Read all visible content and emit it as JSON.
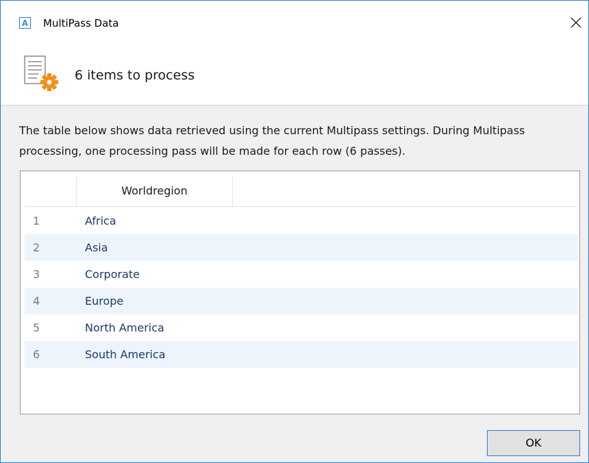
{
  "window": {
    "app_icon_letter": "A",
    "title": "MultiPass Data",
    "close_icon": "close-icon"
  },
  "header": {
    "icon": "document-settings-icon",
    "title": "6 items to process"
  },
  "description": "The table below shows data retrieved using the current Multipass settings. During Multipass processing, one processing pass will be made for each row (6 passes).",
  "table": {
    "columns": [
      "",
      "Worldregion"
    ],
    "rows": [
      {
        "index": "1",
        "value": "Africa"
      },
      {
        "index": "2",
        "value": "Asia"
      },
      {
        "index": "3",
        "value": "Corporate"
      },
      {
        "index": "4",
        "value": "Europe"
      },
      {
        "index": "5",
        "value": "North America"
      },
      {
        "index": "6",
        "value": "South America"
      }
    ]
  },
  "footer": {
    "ok_label": "OK"
  },
  "colors": {
    "accent": "#2a7bd4",
    "row_alt": "#eef4fb",
    "gear": "#f0901e"
  }
}
